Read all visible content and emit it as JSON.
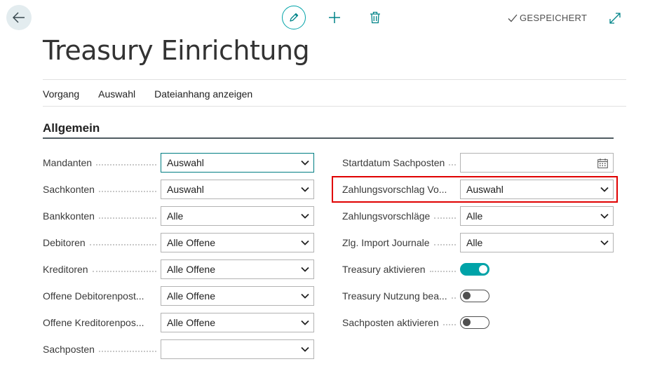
{
  "topbar": {
    "back_icon": "arrow-left-icon",
    "edit_icon": "pencil-icon",
    "new_icon": "plus-icon",
    "delete_icon": "trash-icon",
    "saved_label": "GESPEICHERT",
    "expand_icon": "expand-icon"
  },
  "page": {
    "title": "Treasury Einrichtung"
  },
  "actions": [
    "Vorgang",
    "Auswahl",
    "Dateianhang anzeigen"
  ],
  "section": {
    "title": "Allgemein"
  },
  "left_fields": [
    {
      "label": "Mandanten",
      "value": "Auswahl"
    },
    {
      "label": "Sachkonten",
      "value": "Auswahl"
    },
    {
      "label": "Bankkonten",
      "value": "Alle"
    },
    {
      "label": "Debitoren",
      "value": "Alle Offene"
    },
    {
      "label": "Kreditoren",
      "value": "Alle Offene"
    },
    {
      "label": "Offene Debitorenpost...",
      "value": "Alle Offene"
    },
    {
      "label": "Offene Kreditorenpos...",
      "value": "Alle Offene"
    },
    {
      "label": "Sachposten",
      "value": ""
    }
  ],
  "right_fields": [
    {
      "label": "Startdatum Sachposten",
      "value": ""
    },
    {
      "label": "Zahlungsvorschlag Vo...",
      "value": "Auswahl"
    },
    {
      "label": "Zahlungsvorschläge",
      "value": "Alle"
    },
    {
      "label": "Zlg. Import Journale",
      "value": "Alle"
    },
    {
      "label": "Treasury aktivieren",
      "state": "on"
    },
    {
      "label": "Treasury Nutzung bea...",
      "state": "off"
    },
    {
      "label": "Sachposten aktivieren",
      "state": "off"
    }
  ],
  "colors": {
    "accent": "#00a3a8",
    "highlight": "#e00000"
  }
}
